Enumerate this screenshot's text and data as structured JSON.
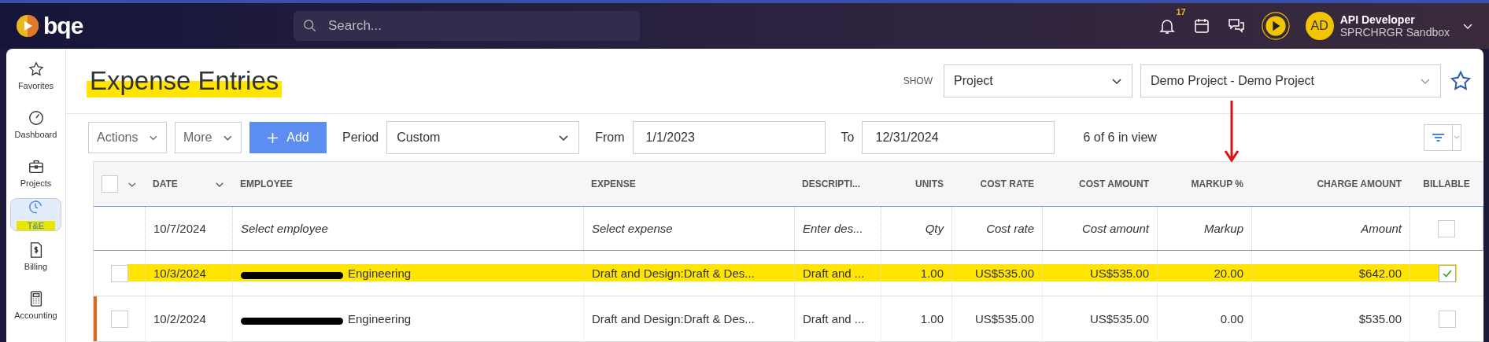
{
  "topbar": {
    "logo": "bqe",
    "search": {
      "placeholder": "Search..."
    },
    "notifications_badge": "17",
    "user": {
      "initials": "AD",
      "name": "API Developer",
      "org": "SPRCHRGR Sandbox"
    }
  },
  "sidebar": {
    "items": [
      {
        "kind": "star",
        "label": "Favorites",
        "selected": false,
        "highlighted": false
      },
      {
        "kind": "gauge",
        "label": "Dashboard",
        "selected": false,
        "highlighted": false
      },
      {
        "kind": "briefcase",
        "label": "Projects",
        "selected": false,
        "highlighted": false
      },
      {
        "kind": "clock",
        "label": "T&E",
        "selected": true,
        "highlighted": true
      },
      {
        "kind": "invoice",
        "label": "Billing",
        "selected": false,
        "highlighted": false
      },
      {
        "kind": "calculator",
        "label": "Accounting",
        "selected": false,
        "highlighted": false
      }
    ]
  },
  "page": {
    "title": "Expense Entries",
    "title_highlighted": true,
    "show_label": "SHOW",
    "show_by": "Project",
    "project": "Demo Project - Demo Project"
  },
  "toolbar": {
    "actions": "Actions",
    "more": "More",
    "add": "Add",
    "period_label": "Period",
    "period": "Custom",
    "from_label": "From",
    "from": "1/1/2023",
    "to_label": "To",
    "to": "12/31/2024",
    "count": "6 of 6 in view"
  },
  "table": {
    "select_all_checked": false,
    "columns": [
      "DATE",
      "EMPLOYEE",
      "EXPENSE",
      "DESCRIPTI...",
      "UNITS",
      "COST RATE",
      "COST AMOUNT",
      "MARKUP %",
      "CHARGE AMOUNT",
      "BILLABLE"
    ],
    "new_row": {
      "date": "10/7/2024",
      "placeholders": [
        "Select employee",
        "Select expense",
        "Enter des...",
        "Qty",
        "Cost rate",
        "Cost amount",
        "Markup",
        "Amount"
      ],
      "billable_checked": false
    },
    "rows": [
      {
        "selected": false,
        "highlighted": true,
        "flagged": false,
        "redacted": true,
        "cells": [
          "10/3/2024",
          "Engineering",
          "Draft and Design:Draft & Des...",
          "Draft and ...",
          "1.00",
          "US$535.00",
          "US$535.00",
          "20.00",
          "$642.00"
        ],
        "billable": true
      },
      {
        "selected": false,
        "highlighted": false,
        "flagged": true,
        "redacted": true,
        "cells": [
          "10/2/2024",
          "Engineering",
          "Draft and Design:Draft & Des...",
          "Draft and ...",
          "1.00",
          "US$535.00",
          "US$535.00",
          "0.00",
          "$535.00"
        ],
        "billable": false
      }
    ]
  },
  "annotation_arrow": true
}
